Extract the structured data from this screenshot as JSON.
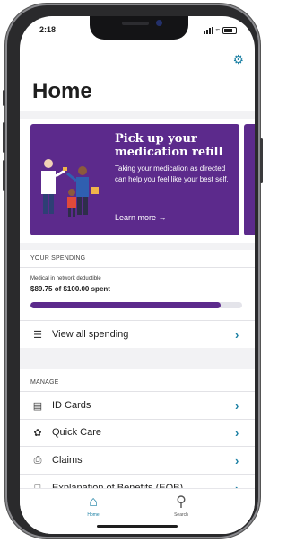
{
  "status_bar": {
    "time": "2:18"
  },
  "header": {
    "title": "Home",
    "settings_icon": "gear-icon"
  },
  "banner": {
    "title": "Pick up your medication refill",
    "body": "Taking your medication as directed can help you feel like your best self.",
    "cta": "Learn more →",
    "bg_color": "#5c2a8c"
  },
  "spending": {
    "section_label": "YOUR SPENDING",
    "deductible_label": "Medical in network deductible",
    "spent_text": "$89.75 of $100.00 spent",
    "progress_fraction": 0.9,
    "view_all": "View all spending"
  },
  "manage": {
    "section_label": "MANAGE",
    "items": [
      {
        "label": "ID Cards",
        "icon": "id-card-icon"
      },
      {
        "label": "Quick Care",
        "icon": "stethoscope-icon"
      },
      {
        "label": "Claims",
        "icon": "printer-icon"
      },
      {
        "label": "Explanation of Benefits (EOB)",
        "icon": "document-icon"
      }
    ]
  },
  "tabbar": {
    "home": "Home",
    "search": "Search"
  },
  "colors": {
    "accent": "#1a7fa3",
    "brand": "#5c2a8c"
  }
}
